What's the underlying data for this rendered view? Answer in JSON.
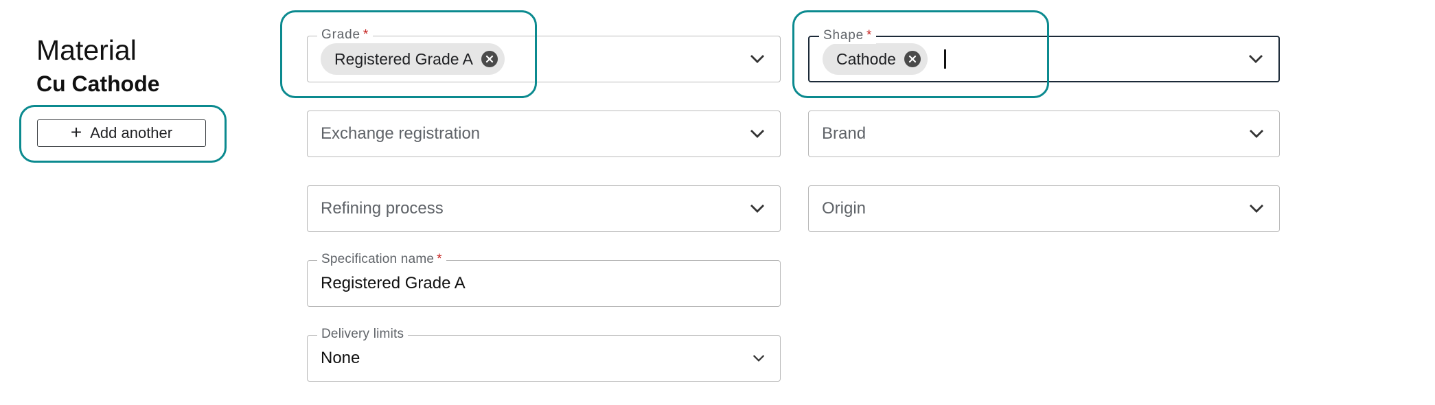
{
  "material": {
    "label": "Material",
    "value": "Cu Cathode",
    "add_label": "Add another"
  },
  "grade": {
    "label": "Grade",
    "required_mark": "*",
    "chip": "Registered Grade A"
  },
  "shape": {
    "label": "Shape",
    "required_mark": "*",
    "chip": "Cathode"
  },
  "exchange_registration": {
    "placeholder": "Exchange registration"
  },
  "brand": {
    "placeholder": "Brand"
  },
  "refining_process": {
    "placeholder": "Refining process"
  },
  "origin": {
    "placeholder": "Origin"
  },
  "specification_name": {
    "label": "Specification name",
    "required_mark": "*",
    "value": "Registered Grade A"
  },
  "delivery_limits": {
    "label": "Delivery limits",
    "value": "None"
  },
  "colors": {
    "highlight": "#0b8a8f",
    "required": "#c5221f",
    "focus_border": "#1c2a38",
    "chip_bg": "#e6e6e6"
  }
}
